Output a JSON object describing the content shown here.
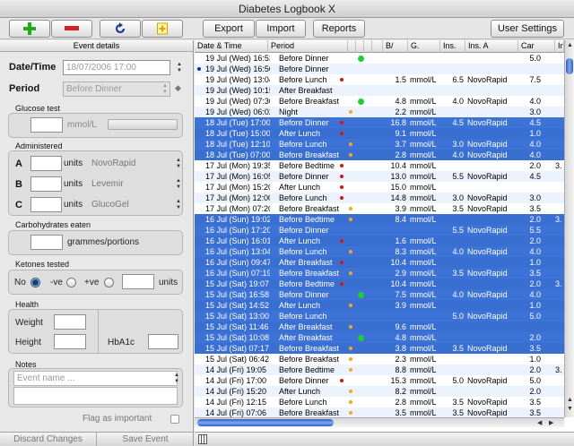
{
  "window": {
    "title": "Diabetes Logbook X"
  },
  "toolbar": {
    "add_icon": "plus-icon",
    "remove_icon": "minus-icon",
    "refresh_icon": "refresh-icon",
    "note_icon": "note-icon",
    "export_label": "Export",
    "import_label": "Import",
    "reports_label": "Reports",
    "settings_label": "User Settings"
  },
  "event_details": {
    "header": "Event details",
    "datetime_label": "Date/Time",
    "datetime_value": "18/07/2006 17:00",
    "period_label": "Period",
    "period_value": "Before Dinner",
    "glucose_section": "Glucose test",
    "glucose_unit": "mmol/L",
    "administered_section": "Administered",
    "insulins": [
      {
        "letter": "A",
        "unit": "units",
        "name": "NovoRapid"
      },
      {
        "letter": "B",
        "unit": "units",
        "name": "Levemir"
      },
      {
        "letter": "C",
        "unit": "units",
        "name": "GlucoGel"
      }
    ],
    "carbs_section": "Carbohydrates eaten",
    "carbs_unit": "grammes/portions",
    "ketones_section": "Ketones tested",
    "ketones_no": "No",
    "ketones_neg": "-ve",
    "ketones_pos": "+ve",
    "ketones_unit": "units",
    "ketones_selected": "No",
    "health_section": "Health",
    "weight_label": "Weight",
    "height_label": "Height",
    "hba1c_label": "HbA1c",
    "notes_section": "Notes",
    "event_name_placeholder": "Event name ...",
    "flag_label": "Flag as important",
    "discard_label": "Discard Changes",
    "save_label": "Save Event"
  },
  "table": {
    "columns": [
      "Date & Time",
      "Period",
      "B/",
      "G.",
      "Ins.",
      "Ins. A",
      "Car",
      "Ins."
    ],
    "colors": {
      "green": "#22cc33",
      "red": "#dd1111",
      "orange": "#f5a623",
      "selected": "#3d73d6"
    },
    "rows": [
      {
        "dt": "19 Jul (Wed) 16:53",
        "period": "Before Dinner",
        "dot": "green",
        "g": "",
        "unit": "",
        "ins": "",
        "insa": "",
        "car": "5.0",
        "ins2": "",
        "sel": false,
        "mark": false
      },
      {
        "dt": "19 Jul (Wed) 16:50",
        "period": "Before Dinner",
        "dot": "",
        "g": "",
        "unit": "",
        "ins": "",
        "insa": "",
        "car": "",
        "ins2": "",
        "sel": false,
        "mark": true
      },
      {
        "dt": "19 Jul (Wed) 13:04",
        "period": "Before Lunch",
        "dot": "red",
        "g": "1.5",
        "unit": "mmol/L",
        "ins": "6.5",
        "insa": "NovoRapid",
        "car": "7.5",
        "ins2": "",
        "sel": false,
        "mark": false
      },
      {
        "dt": "19 Jul (Wed) 10:15",
        "period": "After Breakfast",
        "dot": "",
        "g": "",
        "unit": "",
        "ins": "",
        "insa": "",
        "car": "",
        "ins2": "",
        "sel": false,
        "mark": false
      },
      {
        "dt": "19 Jul (Wed) 07:30",
        "period": "Before Breakfast",
        "dot": "green",
        "g": "4.8",
        "unit": "mmol/L",
        "ins": "4.0",
        "insa": "NovoRapid",
        "car": "4.0",
        "ins2": "",
        "sel": false,
        "mark": false
      },
      {
        "dt": "19 Jul (Wed) 06:02",
        "period": "Night",
        "dot": "orange",
        "g": "2.2",
        "unit": "mmol/L",
        "ins": "",
        "insa": "",
        "car": "3.0",
        "ins2": "",
        "sel": false,
        "mark": false
      },
      {
        "dt": "18 Jul (Tue) 17:00",
        "period": "Before Dinner",
        "dot": "red",
        "g": "16.8",
        "unit": "mmol/L",
        "ins": "4.5",
        "insa": "NovoRapid",
        "car": "4.5",
        "ins2": "",
        "sel": true,
        "mark": false
      },
      {
        "dt": "18 Jul (Tue) 15:00",
        "period": "After Lunch",
        "dot": "red",
        "g": "9.1",
        "unit": "mmol/L",
        "ins": "",
        "insa": "",
        "car": "1.0",
        "ins2": "",
        "sel": true,
        "mark": false
      },
      {
        "dt": "18 Jul (Tue) 12:10",
        "period": "Before Lunch",
        "dot": "orange",
        "g": "3.7",
        "unit": "mmol/L",
        "ins": "3.0",
        "insa": "NovoRapid",
        "car": "4.0",
        "ins2": "",
        "sel": true,
        "mark": false
      },
      {
        "dt": "18 Jul (Tue) 07:00",
        "period": "Before Breakfast",
        "dot": "orange",
        "g": "2.8",
        "unit": "mmol/L",
        "ins": "4.0",
        "insa": "NovoRapid",
        "car": "4.0",
        "ins2": "",
        "sel": true,
        "mark": false
      },
      {
        "dt": "17 Jul (Mon) 19:35",
        "period": "Before Bedtime",
        "dot": "red",
        "g": "10.4",
        "unit": "mmol/L",
        "ins": "",
        "insa": "",
        "car": "2.0",
        "ins2": "3.",
        "sel": false,
        "mark": false
      },
      {
        "dt": "17 Jul (Mon) 16:05",
        "period": "Before Dinner",
        "dot": "red",
        "g": "13.0",
        "unit": "mmol/L",
        "ins": "5.5",
        "insa": "NovoRapid",
        "car": "4.5",
        "ins2": "",
        "sel": false,
        "mark": false
      },
      {
        "dt": "17 Jul (Mon) 15:20",
        "period": "After Lunch",
        "dot": "red",
        "g": "15.0",
        "unit": "mmol/L",
        "ins": "",
        "insa": "",
        "car": "",
        "ins2": "",
        "sel": false,
        "mark": false
      },
      {
        "dt": "17 Jul (Mon) 12:00",
        "period": "Before Lunch",
        "dot": "red",
        "g": "14.8",
        "unit": "mmol/L",
        "ins": "3.0",
        "insa": "NovoRapid",
        "car": "3.0",
        "ins2": "",
        "sel": false,
        "mark": false
      },
      {
        "dt": "17 Jul (Mon) 07:20",
        "period": "Before Breakfast",
        "dot": "orange",
        "g": "3.9",
        "unit": "mmol/L",
        "ins": "3.5",
        "insa": "NovoRapid",
        "car": "3.5",
        "ins2": "",
        "sel": false,
        "mark": false
      },
      {
        "dt": "16 Jul (Sun) 19:02",
        "period": "Before Bedtime",
        "dot": "orange",
        "g": "8.4",
        "unit": "mmol/L",
        "ins": "",
        "insa": "",
        "car": "2.0",
        "ins2": "3.",
        "sel": true,
        "mark": false
      },
      {
        "dt": "16 Jul (Sun) 17:20",
        "period": "Before Dinner",
        "dot": "",
        "g": "",
        "unit": "",
        "ins": "5.5",
        "insa": "NovoRapid",
        "car": "5.5",
        "ins2": "",
        "sel": true,
        "mark": false
      },
      {
        "dt": "16 Jul (Sun) 16:01",
        "period": "After Lunch",
        "dot": "red",
        "g": "1.6",
        "unit": "mmol/L",
        "ins": "",
        "insa": "",
        "car": "2.0",
        "ins2": "",
        "sel": true,
        "mark": false
      },
      {
        "dt": "16 Jul (Sun) 13:04",
        "period": "Before Lunch",
        "dot": "orange",
        "g": "8.3",
        "unit": "mmol/L",
        "ins": "4.0",
        "insa": "NovoRapid",
        "car": "4.0",
        "ins2": "",
        "sel": true,
        "mark": false
      },
      {
        "dt": "16 Jul (Sun) 09:47",
        "period": "After Breakfast",
        "dot": "red",
        "g": "10.4",
        "unit": "mmol/L",
        "ins": "",
        "insa": "",
        "car": "1.0",
        "ins2": "",
        "sel": true,
        "mark": false
      },
      {
        "dt": "16 Jul (Sun) 07:19",
        "period": "Before Breakfast",
        "dot": "orange",
        "g": "2.9",
        "unit": "mmol/L",
        "ins": "3.5",
        "insa": "NovoRapid",
        "car": "3.5",
        "ins2": "",
        "sel": true,
        "mark": false
      },
      {
        "dt": "15 Jul (Sat) 19:07",
        "period": "Before Bedtime",
        "dot": "red",
        "g": "10.4",
        "unit": "mmol/L",
        "ins": "",
        "insa": "",
        "car": "2.0",
        "ins2": "3.",
        "sel": true,
        "mark": false
      },
      {
        "dt": "15 Jul (Sat) 16:58",
        "period": "Before Dinner",
        "dot": "green",
        "g": "7.5",
        "unit": "mmol/L",
        "ins": "4.0",
        "insa": "NovoRapid",
        "car": "4.0",
        "ins2": "",
        "sel": true,
        "mark": false
      },
      {
        "dt": "15 Jul (Sat) 14:52",
        "period": "After Lunch",
        "dot": "orange",
        "g": "3.9",
        "unit": "mmol/L",
        "ins": "",
        "insa": "",
        "car": "1.0",
        "ins2": "",
        "sel": true,
        "mark": false
      },
      {
        "dt": "15 Jul (Sat) 13:00",
        "period": "Before Lunch",
        "dot": "",
        "g": "",
        "unit": "",
        "ins": "5.0",
        "insa": "NovoRapid",
        "car": "5.0",
        "ins2": "",
        "sel": true,
        "mark": false
      },
      {
        "dt": "15 Jul (Sat) 11:46",
        "period": "After Breakfast",
        "dot": "orange",
        "g": "9.6",
        "unit": "mmol/L",
        "ins": "",
        "insa": "",
        "car": "",
        "ins2": "",
        "sel": true,
        "mark": false
      },
      {
        "dt": "15 Jul (Sat) 10:08",
        "period": "After Breakfast",
        "dot": "green",
        "g": "4.8",
        "unit": "mmol/L",
        "ins": "",
        "insa": "",
        "car": "2.0",
        "ins2": "",
        "sel": true,
        "mark": false
      },
      {
        "dt": "15 Jul (Sat) 07:17",
        "period": "Before Breakfast",
        "dot": "orange",
        "g": "3.8",
        "unit": "mmol/L",
        "ins": "3.5",
        "insa": "NovoRapid",
        "car": "3.5",
        "ins2": "",
        "sel": true,
        "mark": false
      },
      {
        "dt": "15 Jul (Sat) 06:42",
        "period": "Before Breakfast",
        "dot": "orange",
        "g": "2.3",
        "unit": "mmol/L",
        "ins": "",
        "insa": "",
        "car": "1.0",
        "ins2": "",
        "sel": false,
        "mark": false
      },
      {
        "dt": "14 Jul (Fri) 19:05",
        "period": "Before Bedtime",
        "dot": "orange",
        "g": "8.8",
        "unit": "mmol/L",
        "ins": "",
        "insa": "",
        "car": "2.0",
        "ins2": "3.",
        "sel": false,
        "mark": false
      },
      {
        "dt": "14 Jul (Fri) 17:00",
        "period": "Before Dinner",
        "dot": "red",
        "g": "15.3",
        "unit": "mmol/L",
        "ins": "5.0",
        "insa": "NovoRapid",
        "car": "5.0",
        "ins2": "",
        "sel": false,
        "mark": false
      },
      {
        "dt": "14 Jul (Fri) 15:20",
        "period": "After Lunch",
        "dot": "orange",
        "g": "8.2",
        "unit": "mmol/L",
        "ins": "",
        "insa": "",
        "car": "2.0",
        "ins2": "",
        "sel": false,
        "mark": false
      },
      {
        "dt": "14 Jul (Fri) 12:15",
        "period": "Before Lunch",
        "dot": "orange",
        "g": "2.8",
        "unit": "mmol/L",
        "ins": "3.5",
        "insa": "NovoRapid",
        "car": "3.5",
        "ins2": "",
        "sel": false,
        "mark": false
      },
      {
        "dt": "14 Jul (Fri) 07:06",
        "period": "Before Breakfast",
        "dot": "orange",
        "g": "3.5",
        "unit": "mmol/L",
        "ins": "3.5",
        "insa": "NovoRapid",
        "car": "3.5",
        "ins2": "",
        "sel": false,
        "mark": false
      }
    ]
  }
}
